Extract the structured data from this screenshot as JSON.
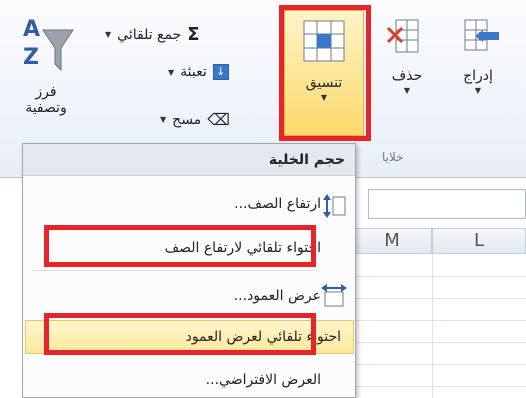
{
  "ribbon": {
    "insert_label": "إدراج",
    "delete_label": "حذف",
    "format_label": "تنسيق",
    "cells_group_label": "خلايا",
    "autosum_label": "جمع تلقائي",
    "fill_label": "تعبئة",
    "clear_label": "مسح",
    "sort_filter_label_1": "فرز",
    "sort_filter_label_2": "وتصفية"
  },
  "menu": {
    "header": "حجم الخلية",
    "items": [
      {
        "label": "ارتفاع الصف..."
      },
      {
        "label": "احتواء تلقائي لارتفاع الصف"
      },
      {
        "label": "عرض العمود..."
      },
      {
        "label": "احتواء تلقائي لعرض العمود"
      },
      {
        "label": "العرض الافتراضي..."
      }
    ]
  },
  "sheet": {
    "col_m": "M",
    "col_l": "L"
  },
  "colors": {
    "highlight_red": "#e8232b",
    "hover_yellow": "#fde89a"
  }
}
